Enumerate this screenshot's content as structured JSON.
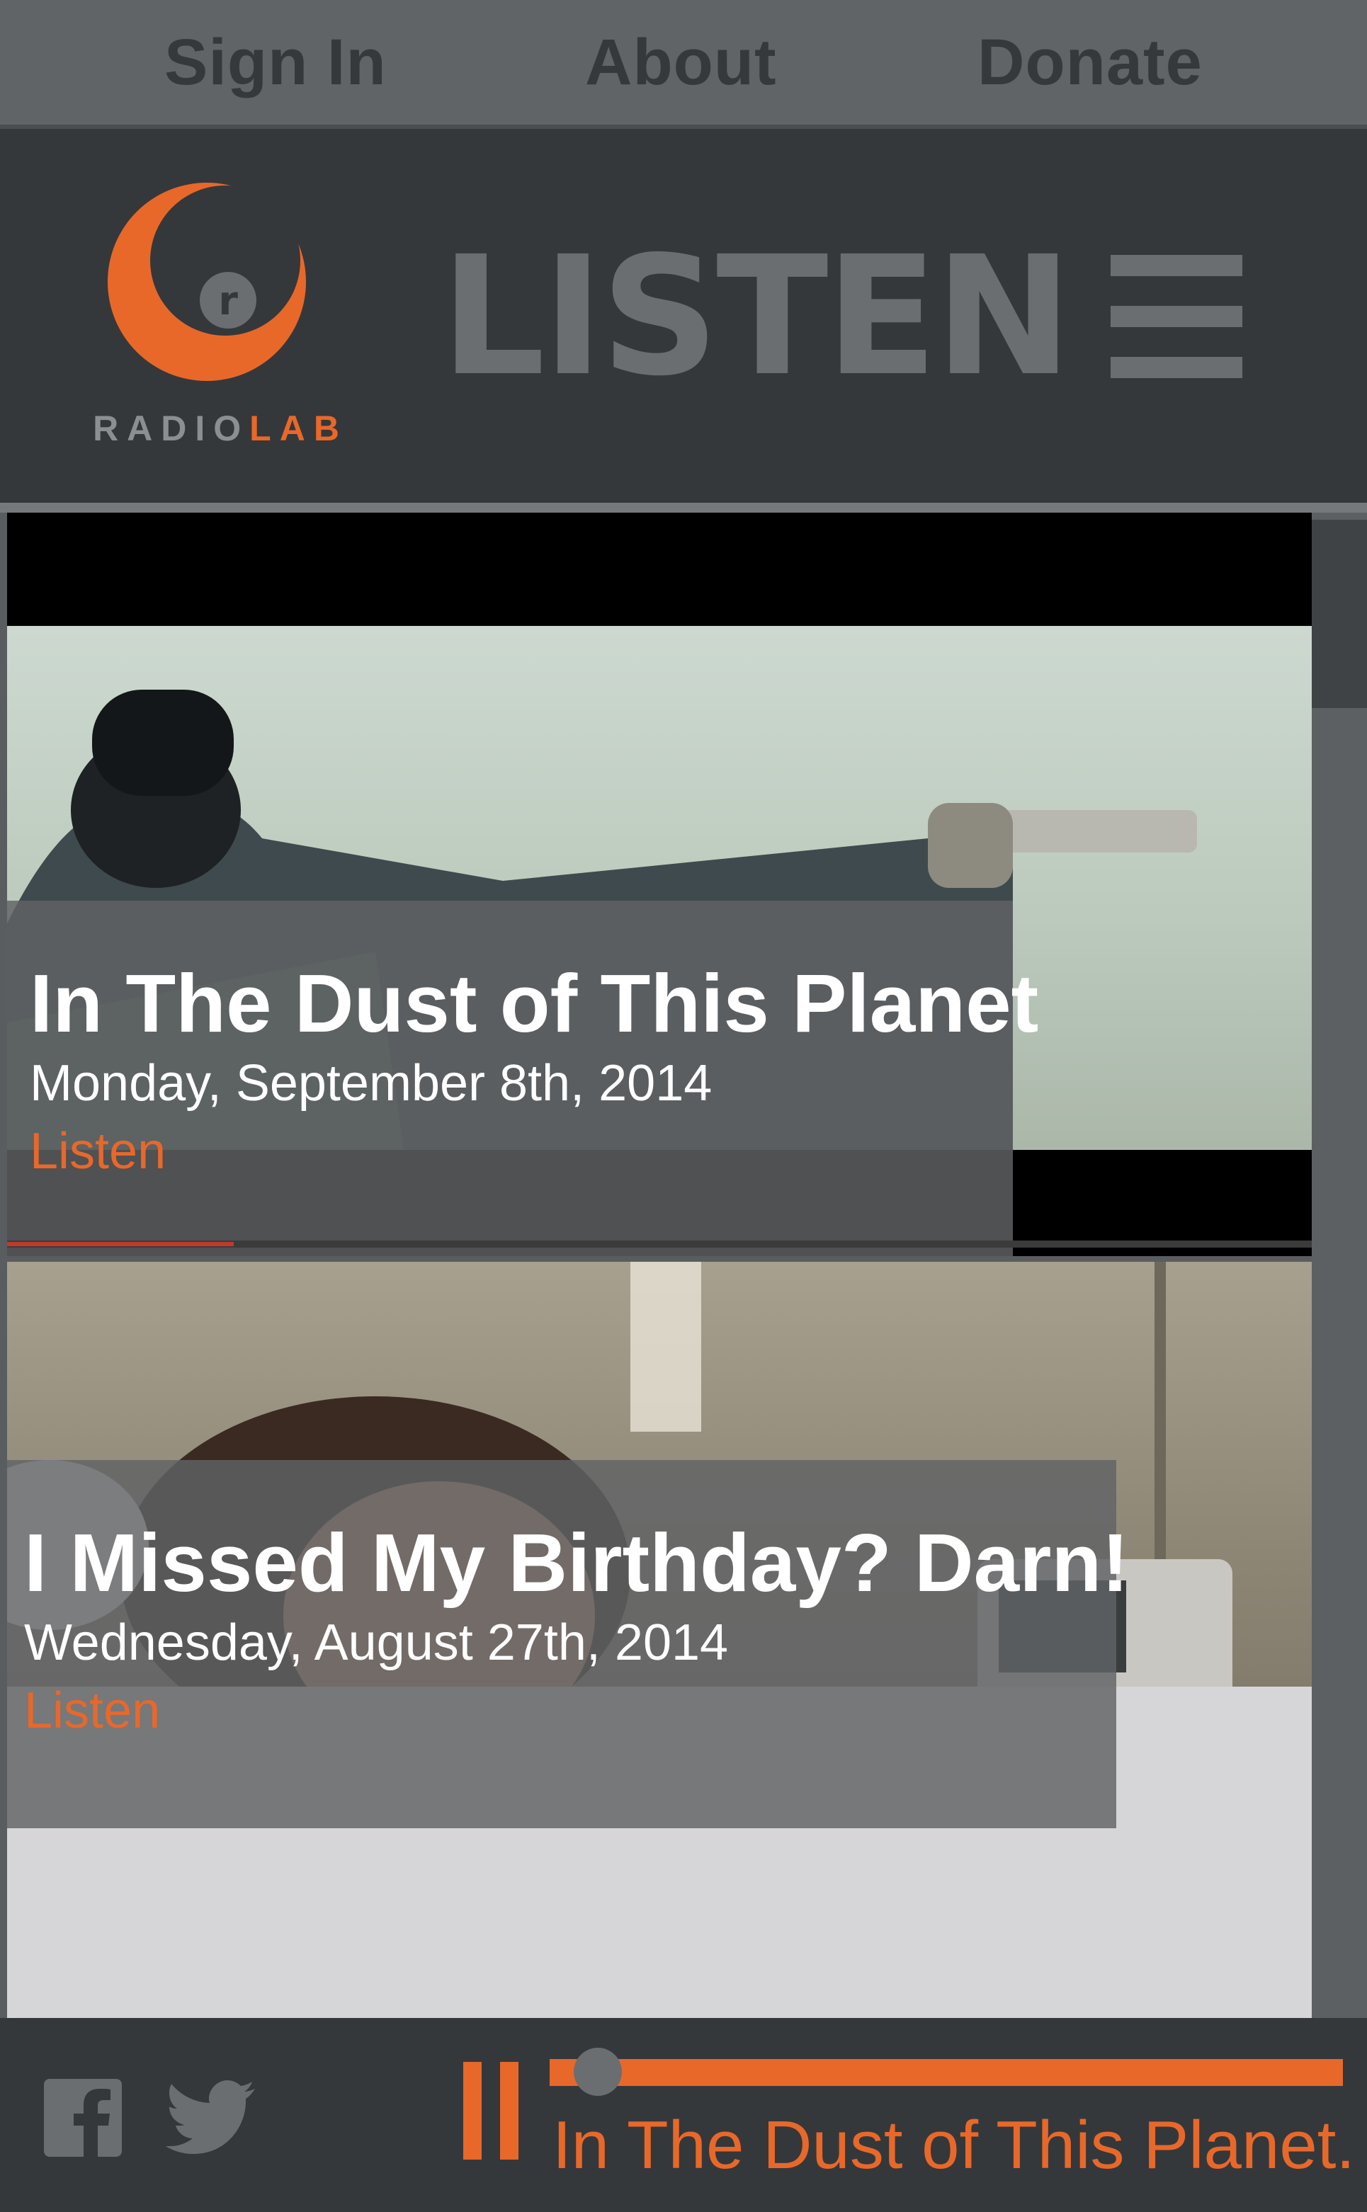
{
  "nav": {
    "sign_in": "Sign In",
    "about": "About",
    "donate": "Donate"
  },
  "header": {
    "logo_radio": "RADIO",
    "logo_lab": "LAB",
    "title": "LISTEN"
  },
  "episodes": [
    {
      "title": "In The Dust of This Planet",
      "date": "Monday, September 8th, 2014",
      "listen": "Listen"
    },
    {
      "title": "I Missed My Birthday? Darn!",
      "date": "Wednesday, August 27th, 2014",
      "listen": "Listen"
    }
  ],
  "player": {
    "now_playing": "In The Dust of This Planet...",
    "progress": 0.03
  },
  "colors": {
    "accent": "#e8682a",
    "nav_bg": "#606466",
    "header_bg": "#34383a",
    "muted_text": "#6a6e70"
  },
  "icons": [
    "facebook-icon",
    "twitter-icon",
    "pause-icon",
    "menu-icon",
    "radiolab-logo"
  ]
}
